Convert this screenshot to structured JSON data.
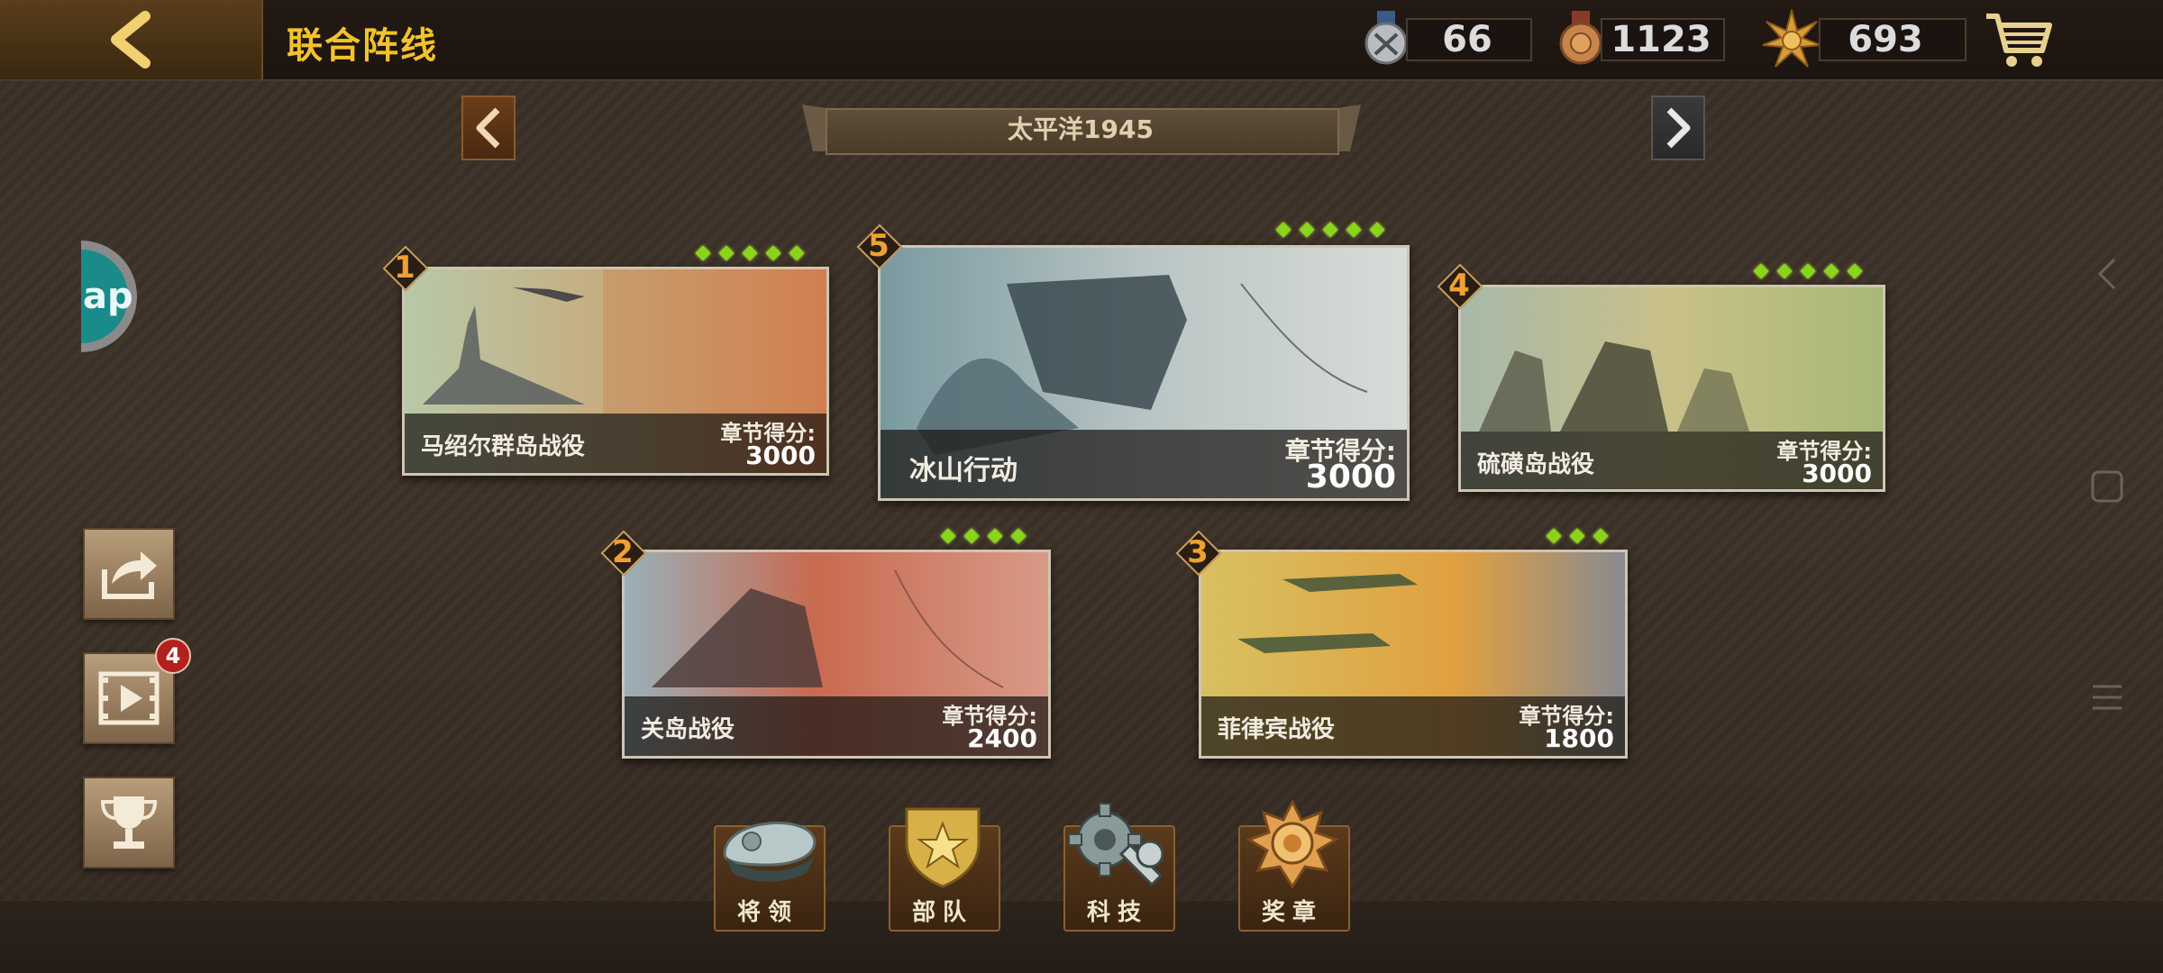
{
  "header": {
    "title": "联合阵线",
    "resources": [
      {
        "icon": "silver-medal-icon",
        "value": "66"
      },
      {
        "icon": "bronze-medal-icon",
        "value": "1123"
      },
      {
        "icon": "sun-badge-icon",
        "value": "693"
      }
    ]
  },
  "chapter": {
    "name": "太平洋1945"
  },
  "side": {
    "ap_label": "ap",
    "video_badge": "4"
  },
  "missions": [
    {
      "order": "1",
      "name": "马绍尔群岛战役",
      "score_label": "章节得分:",
      "score": "3000",
      "stars": 5
    },
    {
      "order": "5",
      "name": "冰山行动",
      "score_label": "章节得分:",
      "score": "3000",
      "stars": 5
    },
    {
      "order": "4",
      "name": "硫磺岛战役",
      "score_label": "章节得分:",
      "score": "3000",
      "stars": 5
    },
    {
      "order": "2",
      "name": "关岛战役",
      "score_label": "章节得分:",
      "score": "2400",
      "stars": 4
    },
    {
      "order": "3",
      "name": "菲律宾战役",
      "score_label": "章节得分:",
      "score": "1800",
      "stars": 3
    }
  ],
  "bottom_menu": [
    {
      "label": "将领",
      "icon": "officer-cap-icon"
    },
    {
      "label": "部队",
      "icon": "shield-star-icon"
    },
    {
      "label": "科技",
      "icon": "gear-wrench-icon"
    },
    {
      "label": "奖章",
      "icon": "medal-icon"
    }
  ],
  "colors": {
    "title": "#f3c12e",
    "star": "#8ad41c",
    "order_number": "#f0a030",
    "badge": "#b3201e"
  }
}
